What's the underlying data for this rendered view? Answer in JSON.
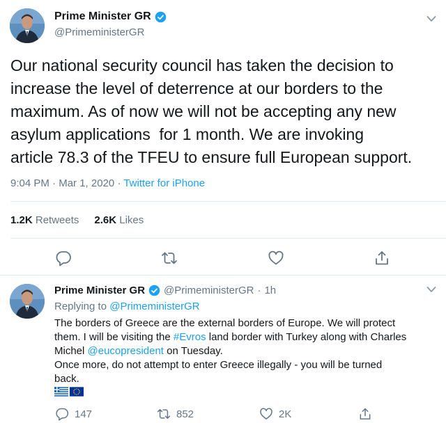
{
  "main_tweet": {
    "display_name": "Prime Minister GR",
    "handle": "@PrimeministerGR",
    "text_lines": [
      "Our national security council has taken the decision to",
      "increase the level of deterrence at our borders to the",
      "maximum. As of now we will not be accepting any new",
      "asylum applications  for 1 month. We are invoking",
      "article 78.3 of the TFEU to ensure full European support."
    ],
    "time": "9:04 PM",
    "sep1": "·",
    "date": "Mar 1, 2020",
    "sep2": "·",
    "source": "Twitter for iPhone",
    "retweets_count": "1.2K",
    "retweets_label": "Retweets",
    "likes_count": "2.6K",
    "likes_label": "Likes"
  },
  "reply_tweet": {
    "display_name": "Prime Minister GR",
    "handle": "@PrimeministerGR",
    "sep": "·",
    "age": "1h",
    "replying_prefix": "Replying to",
    "replying_to": "@PrimeministerGR",
    "line1": "The borders of Greece are the external borders of Europe. We will protect",
    "line2_a": "them. I will be visiting the ",
    "line2_hashtag": "#Evros",
    "line2_b": " land border with Turkey along with Charles",
    "line3_a": "Michel ",
    "line3_mention": "@eucopresident",
    "line3_b": " on Tuesday.",
    "line4": "Once more, do not attempt to enter Greece illegally - you will be turned",
    "line5": "back.",
    "flags": [
      "greece-flag",
      "eu-flag"
    ],
    "reply_count": "147",
    "retweet_count": "852",
    "like_count": "2K"
  },
  "colors": {
    "accent": "#1da1f2",
    "secondary_text": "#657786",
    "primary_text": "#14171a",
    "divider": "#e1e8ed"
  },
  "icons": [
    "verified-badge-icon",
    "chevron-down-icon",
    "reply-icon",
    "retweet-icon",
    "like-icon",
    "share-icon"
  ]
}
